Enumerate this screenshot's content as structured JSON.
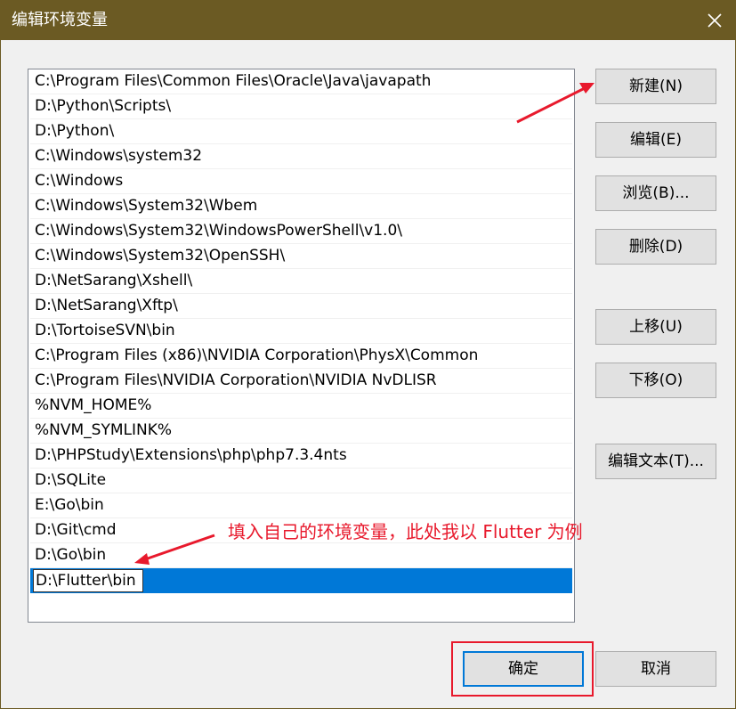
{
  "window": {
    "title": "编辑环境变量"
  },
  "icons": {
    "close": "close-icon",
    "arrow_to_new": "arrow-icon",
    "arrow_to_entry": "arrow-icon"
  },
  "colors": {
    "titlebar": "#6b5a23",
    "selection": "#0078d7",
    "annotation": "#e8192c"
  },
  "path_list": {
    "items": [
      "C:\\Program Files\\Common Files\\Oracle\\Java\\javapath",
      "D:\\Python\\Scripts\\",
      "D:\\Python\\",
      "C:\\Windows\\system32",
      "C:\\Windows",
      "C:\\Windows\\System32\\Wbem",
      "C:\\Windows\\System32\\WindowsPowerShell\\v1.0\\",
      "C:\\Windows\\System32\\OpenSSH\\",
      "D:\\NetSarang\\Xshell\\",
      "D:\\NetSarang\\Xftp\\",
      "D:\\TortoiseSVN\\bin",
      "C:\\Program Files (x86)\\NVIDIA Corporation\\PhysX\\Common",
      "C:\\Program Files\\NVIDIA Corporation\\NVIDIA NvDLISR",
      "%NVM_HOME%",
      "%NVM_SYMLINK%",
      "D:\\PHPStudy\\Extensions\\php\\php7.3.4nts",
      "D:\\SQLite",
      "E:\\Go\\bin",
      "D:\\Git\\cmd",
      "D:\\Go\\bin"
    ],
    "editing_value": "D:\\Flutter\\bin"
  },
  "buttons": {
    "new": "新建(N)",
    "edit": "编辑(E)",
    "browse": "浏览(B)...",
    "delete": "删除(D)",
    "move_up": "上移(U)",
    "move_down": "下移(O)",
    "edit_text": "编辑文本(T)...",
    "ok": "确定",
    "cancel": "取消"
  },
  "annotation": {
    "text": "填入自己的环境变量，此处我以 Flutter 为例"
  }
}
